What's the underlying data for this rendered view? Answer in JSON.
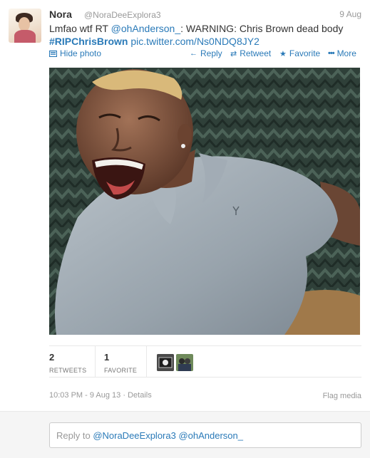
{
  "tweet": {
    "name": "Nora",
    "handle": "@NoraDeeExplora3",
    "time": "9 Aug",
    "text_prefix": "Lmfao wtf RT ",
    "mention": "@ohAnderson_",
    "text_middle": ": WARNING: Chris Brown dead body",
    "hashtag": "#RIPChrisBrown",
    "link": "pic.twitter.com/Ns0NDQ8JY2"
  },
  "actions": {
    "hide_photo": "Hide photo",
    "reply": "Reply",
    "retweet": "Retweet",
    "favorite": "Favorite",
    "more": "More"
  },
  "stats": {
    "retweets_count": "2",
    "retweets_label": "RETWEETS",
    "favorites_count": "1",
    "favorites_label": "FAVORITE"
  },
  "footer": {
    "timestamp": "10:03 PM - 9 Aug 13",
    "separator": " · ",
    "details": "Details",
    "flag": "Flag media"
  },
  "reply": {
    "prefix": "Reply to ",
    "mentions": "@NoraDeeExplora3 @ohAnderson_"
  },
  "icons": {
    "hide_photo": "photo-icon",
    "reply": "reply-arrow-icon",
    "retweet": "retweet-icon",
    "favorite": "star-icon",
    "more": "dots-icon"
  },
  "colors": {
    "link": "#2a7ab8",
    "muted": "#999999",
    "text": "#333333"
  }
}
